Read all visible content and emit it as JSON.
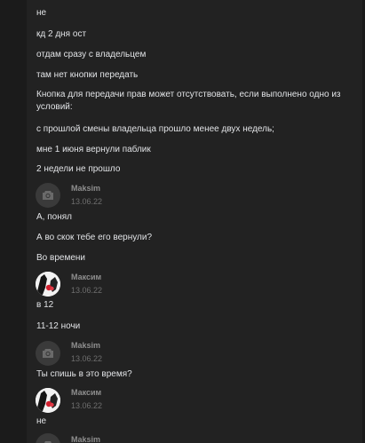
{
  "messages": [
    {
      "text": "не"
    },
    {
      "text": "кд 2 дня ост"
    },
    {
      "text": "отдам сразу с владельцем"
    },
    {
      "text": "там нет кнопки передать"
    },
    {
      "text": "Кнопка для передачи прав может отсутствовать, если выполнено одно из условий:"
    },
    {
      "text": "с прошлой смены владельца прошло менее двух недель;"
    },
    {
      "text": "мне 1 июня вернули паблик"
    },
    {
      "text": "2 недели не прошло"
    },
    {
      "text": "А, понял"
    },
    {
      "text": "А во скок тебе его вернули?"
    },
    {
      "text": "Во времени"
    },
    {
      "text": "в 12"
    },
    {
      "text": "11-12 ночи"
    },
    {
      "text": "Ты спишь в это время?"
    },
    {
      "text": "не"
    }
  ],
  "headers": [
    {
      "author": "Maksim",
      "date": "13.06.22",
      "avatar": "camera-icon"
    },
    {
      "author": "Максим",
      "date": "13.06.22",
      "avatar": "profile-photo"
    },
    {
      "author": "Maksim",
      "date": "13.06.22",
      "avatar": "camera-icon"
    },
    {
      "author": "Максим",
      "date": "13.06.22",
      "avatar": "profile-photo"
    },
    {
      "author": "Maksim",
      "date": "",
      "avatar": "camera-icon"
    }
  ]
}
